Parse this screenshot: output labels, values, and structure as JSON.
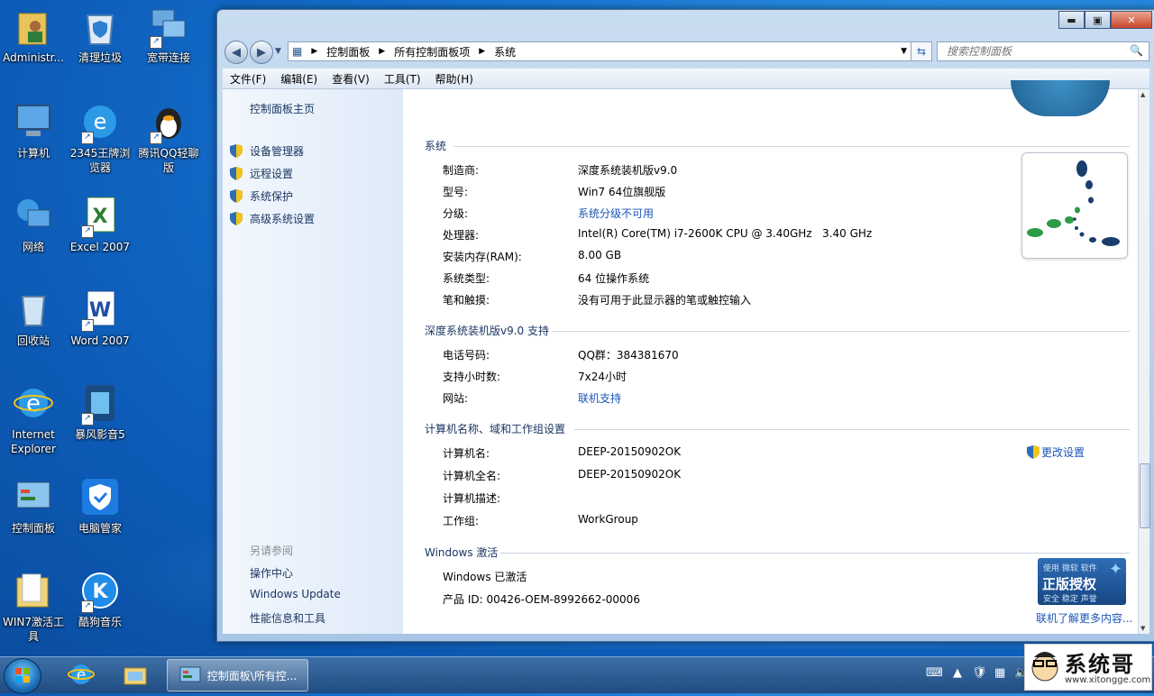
{
  "desktop": {
    "icons": [
      {
        "label": "Administr..."
      },
      {
        "label": "清理垃圾"
      },
      {
        "label": "宽带连接"
      },
      {
        "label": "计算机"
      },
      {
        "label": "2345王牌浏览器"
      },
      {
        "label": "腾讯QQ轻聊版"
      },
      {
        "label": "网络"
      },
      {
        "label": "Excel 2007"
      },
      {
        "label": "回收站"
      },
      {
        "label": "Word 2007"
      },
      {
        "label": "Internet Explorer"
      },
      {
        "label": "暴风影音5"
      },
      {
        "label": "控制面板"
      },
      {
        "label": "电脑管家"
      },
      {
        "label": "WIN7激活工具"
      },
      {
        "label": "酷狗音乐"
      }
    ]
  },
  "window": {
    "breadcrumb": [
      "控制面板",
      "所有控制面板项",
      "系统"
    ],
    "search_placeholder": "搜索控制面板",
    "menu": [
      "文件(F)",
      "编辑(E)",
      "查看(V)",
      "工具(T)",
      "帮助(H)"
    ],
    "left": {
      "home": "控制面板主页",
      "links": [
        "设备管理器",
        "远程设置",
        "系统保护",
        "高级系统设置"
      ],
      "see_also": "另请参阅",
      "related": [
        "操作中心",
        "Windows Update",
        "性能信息和工具"
      ]
    },
    "system": {
      "title": "系统",
      "rows": [
        {
          "label": "制造商:",
          "value": "深度系统装机版v9.0"
        },
        {
          "label": "型号:",
          "value": "Win7 64位旗舰版"
        },
        {
          "label": "分级:",
          "value": "系统分级不可用"
        },
        {
          "label": "处理器:",
          "value": "Intel(R) Core(TM) i7-2600K CPU @ 3.40GHz   3.40 GHz"
        },
        {
          "label": "安装内存(RAM):",
          "value": "8.00 GB"
        },
        {
          "label": "系统类型:",
          "value": "64 位操作系统"
        },
        {
          "label": "笔和触摸:",
          "value": "没有可用于此显示器的笔或触控输入"
        }
      ]
    },
    "support": {
      "title": "深度系统装机版v9.0 支持",
      "rows": [
        {
          "label": "电话号码:",
          "value": "QQ群：384381670"
        },
        {
          "label": "支持小时数:",
          "value": "7x24小时"
        },
        {
          "label": "网站:",
          "value": "联机支持"
        }
      ]
    },
    "computer": {
      "title": "计算机名称、域和工作组设置",
      "change": "更改设置",
      "rows": [
        {
          "label": "计算机名:",
          "value": "DEEP-20150902OK"
        },
        {
          "label": "计算机全名:",
          "value": "DEEP-20150902OK"
        },
        {
          "label": "计算机描述:",
          "value": ""
        },
        {
          "label": "工作组:",
          "value": "WorkGroup"
        }
      ]
    },
    "activation": {
      "title": "Windows 激活",
      "status": "Windows 已激活",
      "product_id": "产品 ID: 00426-OEM-8992662-00006",
      "genuine_top": "使用 微软 软件",
      "genuine_main": "正版授权",
      "genuine_sub": "安全 稳定 声誉",
      "learn_more": "联机了解更多内容..."
    }
  },
  "taskbar": {
    "active_window": "控制面板\\所有控..."
  },
  "watermark": {
    "name": "系统哥",
    "url": "www.xitongge.com"
  }
}
